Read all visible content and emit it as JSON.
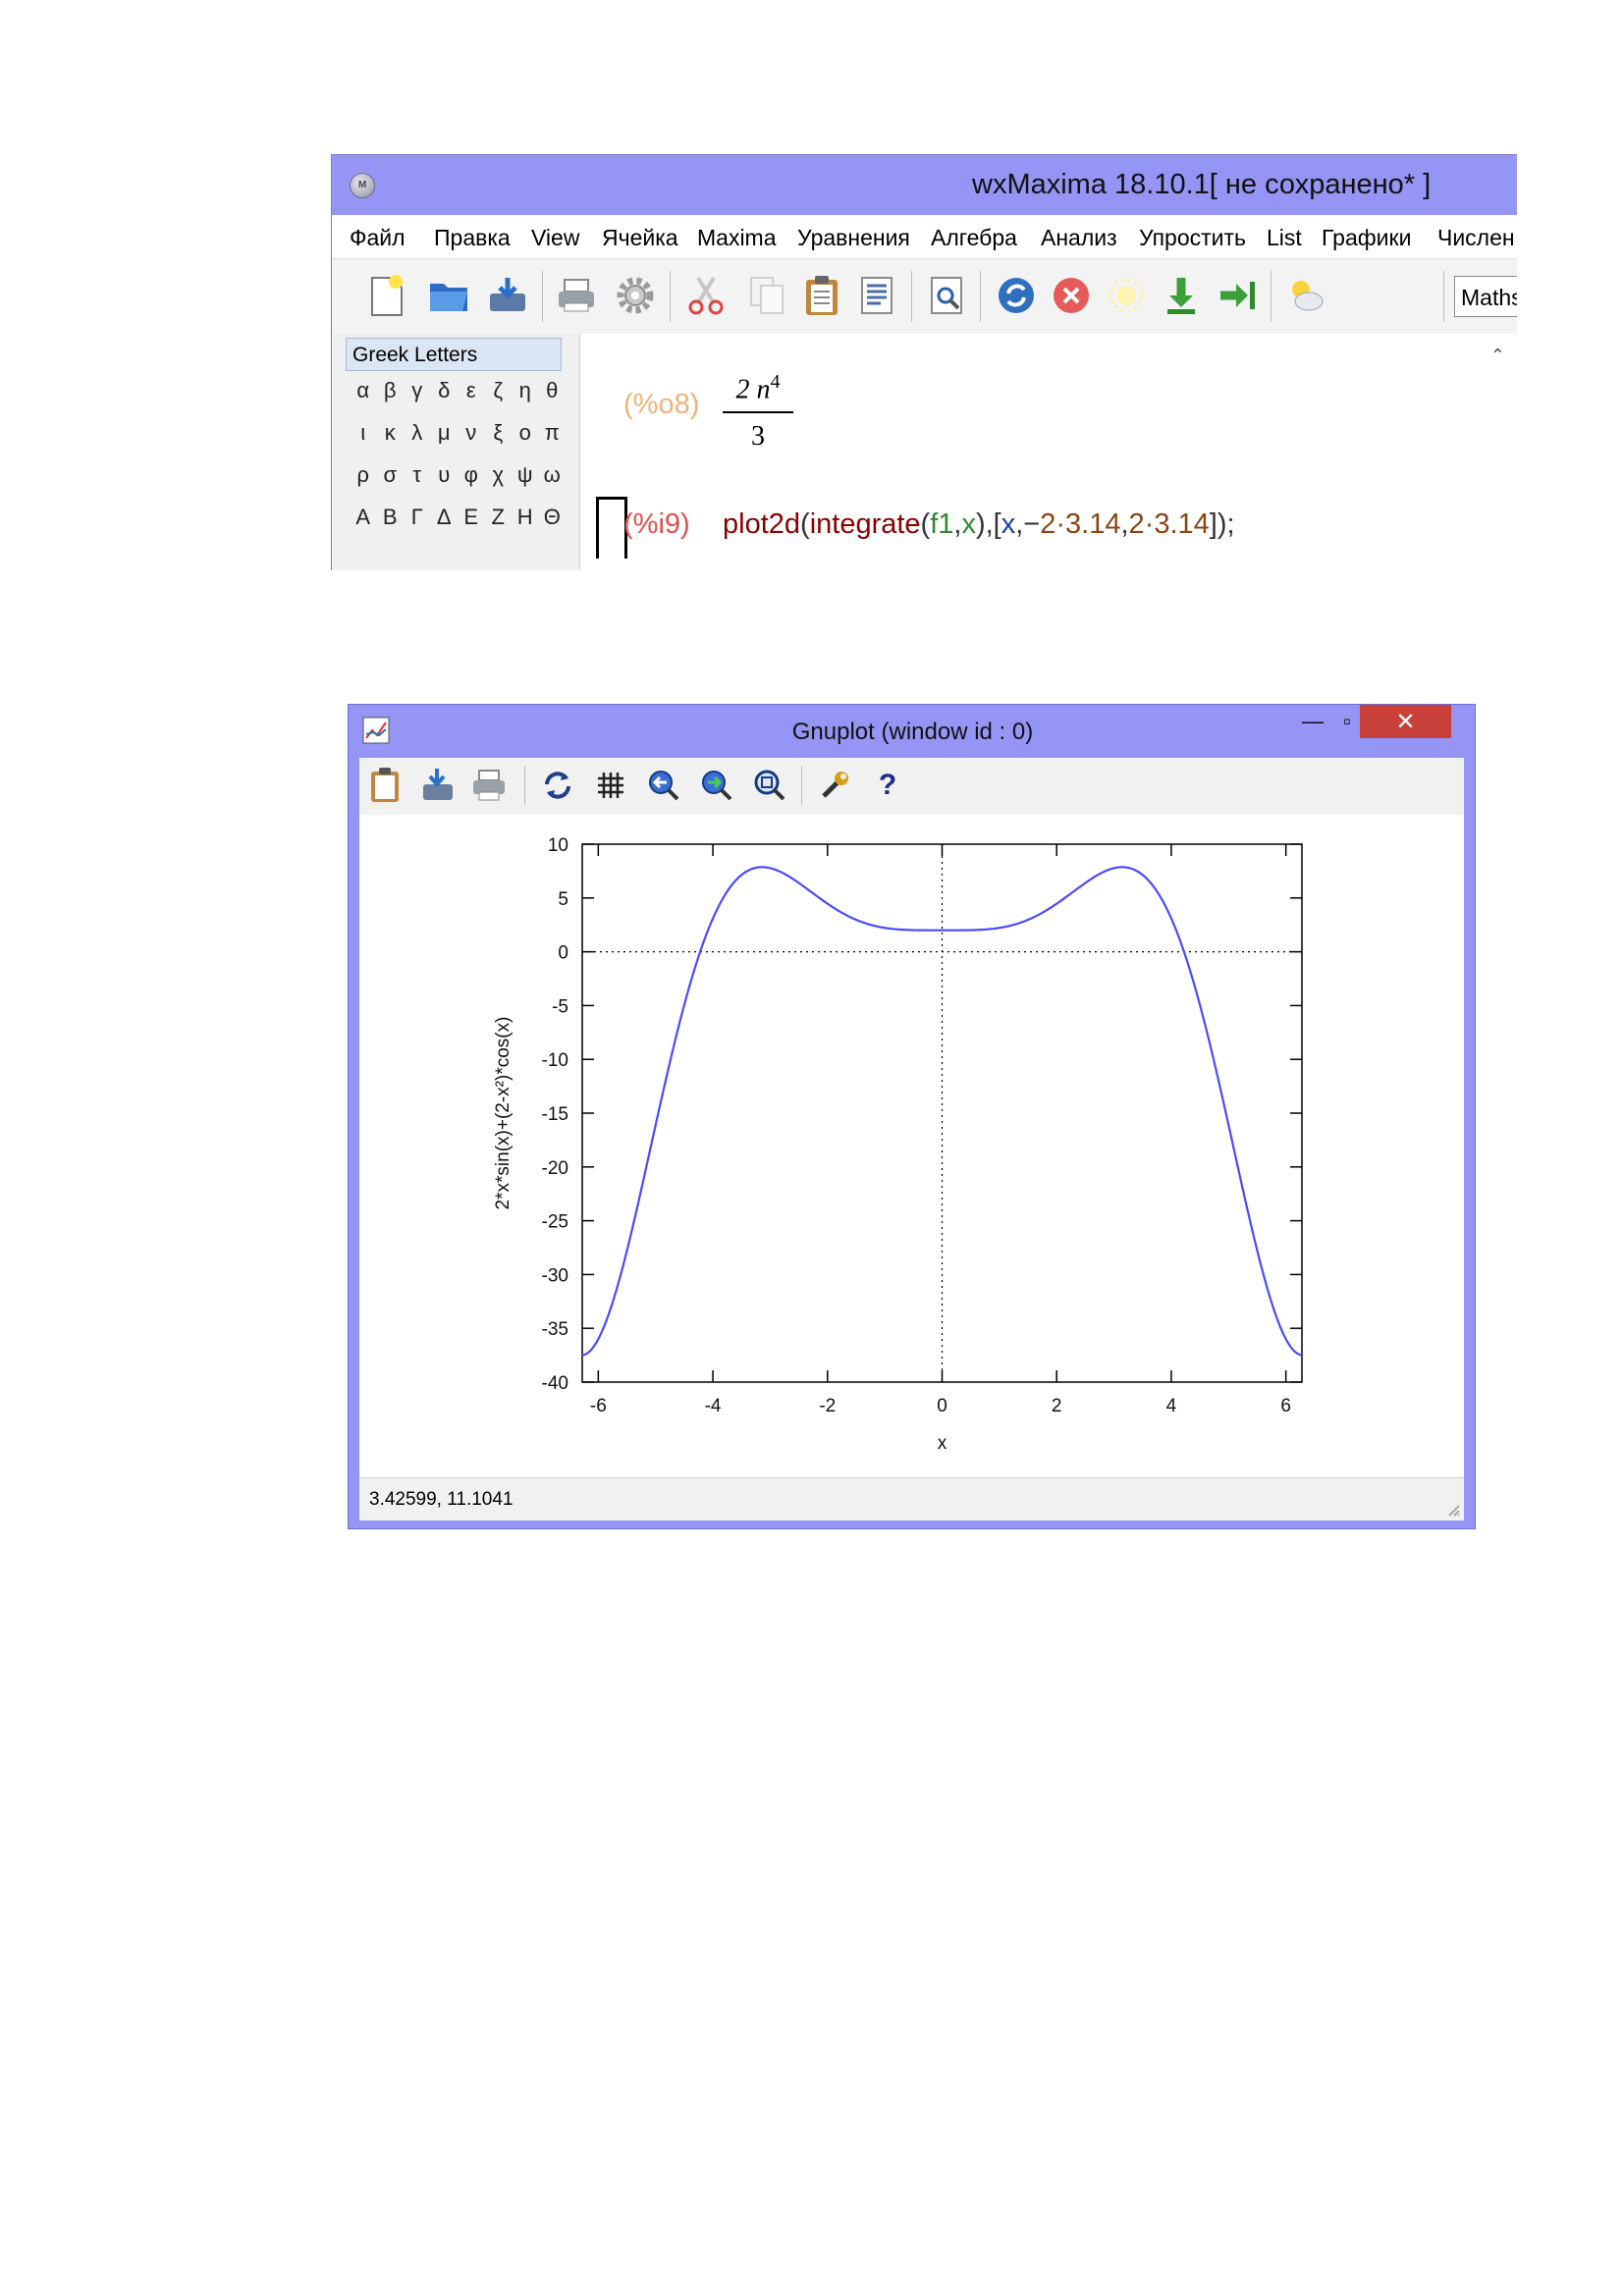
{
  "wxmaxima": {
    "title": "wxMaxima 18.10.1[ не сохранено* ]",
    "menu": [
      "Файл",
      "Правка",
      "View",
      "Ячейка",
      "Maxima",
      "Уравнения",
      "Алгебра",
      "Анализ",
      "Упростить",
      "List",
      "Графики",
      "Числен"
    ],
    "combo_value": "Maths",
    "panel_title": "Greek Letters",
    "greek_rows": [
      [
        "α",
        "β",
        "γ",
        "δ",
        "ε",
        "ζ",
        "η",
        "θ"
      ],
      [
        "ι",
        "κ",
        "λ",
        "μ",
        "ν",
        "ξ",
        "ο",
        "π"
      ],
      [
        "ρ",
        "σ",
        "τ",
        "υ",
        "φ",
        "χ",
        "ψ",
        "ω"
      ],
      [
        "Α",
        "Β",
        "Γ",
        "Δ",
        "Ε",
        "Ζ",
        "Η",
        "Θ"
      ]
    ],
    "cells": {
      "out_label": "(%o8)",
      "out_numerator": "2 n",
      "out_exponent": "4",
      "out_denominator": "3",
      "in_label": "(%i9)",
      "in_code": {
        "fn": "plot2d",
        "p1": "(",
        "fn2": "integrate",
        "p2": "(",
        "arg1": "f1",
        "c1": ",",
        "arg2": "x",
        "p3": "),[",
        "arg3": "x",
        "c2": ",−",
        "n1": "2·3.14",
        "c3": ",",
        "n2": "2·3.14",
        "end": "]);"
      }
    }
  },
  "gnuplot": {
    "title": "Gnuplot (window id : 0)",
    "status": "3.42599,  11.1041",
    "accent_title_bar": "#9495f4",
    "close_color": "#c7403a",
    "toolbar_icons": [
      "clipboard-icon",
      "export-icon",
      "print-icon",
      "replot-icon",
      "grid-icon",
      "zoom-previous-icon",
      "zoom-next-icon",
      "unzoom-icon",
      "options-icon",
      "help-icon"
    ]
  },
  "chart_data": {
    "type": "line",
    "title": "",
    "xlabel": "x",
    "ylabel": "2*x*sin(x)+(2-x²)*cos(x)",
    "xlim": [
      -6.28,
      6.28
    ],
    "ylim": [
      -40,
      10
    ],
    "xticks": [
      -6,
      -4,
      -2,
      0,
      2,
      4,
      6
    ],
    "yticks": [
      10,
      5,
      0,
      -5,
      -10,
      -15,
      -20,
      -25,
      -30,
      -35,
      -40
    ],
    "zero_axes_dotted": true,
    "series": [
      {
        "function": "2*x*sin(x)+(2-x^2)*cos(x)",
        "color": "#4a4aff"
      }
    ]
  }
}
